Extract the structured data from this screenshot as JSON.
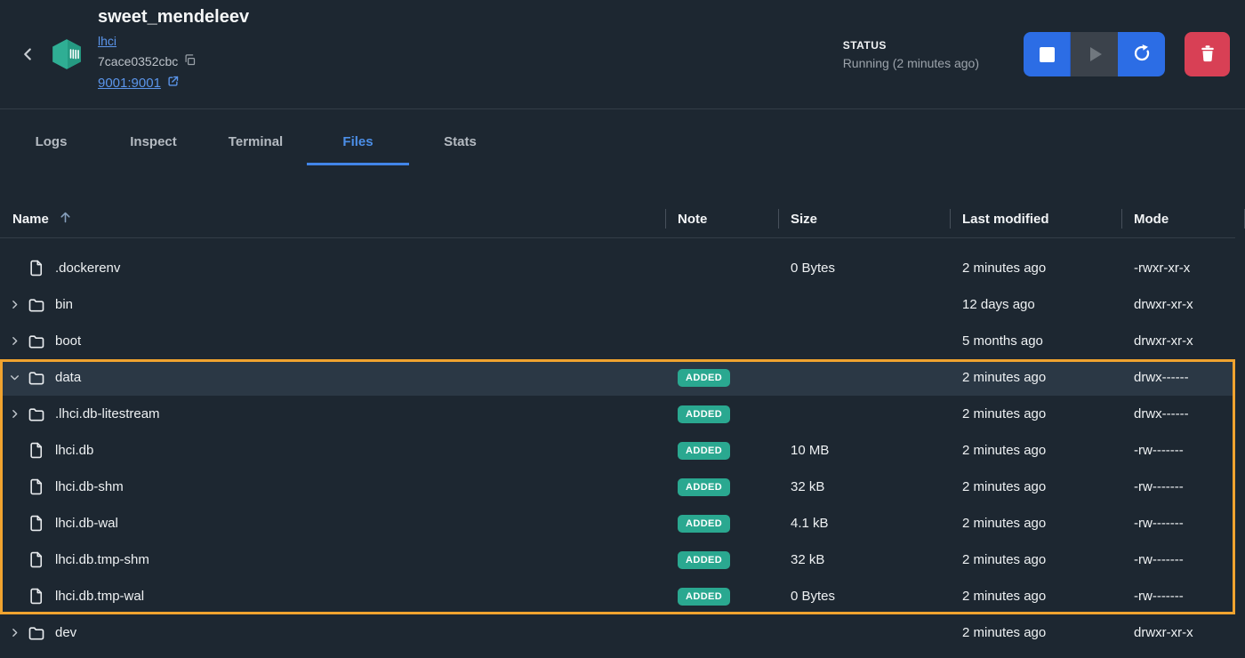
{
  "header": {
    "title": "sweet_mendeleev",
    "image_link": "lhci",
    "container_id": "7cace0352cbc",
    "port_mapping": "9001:9001",
    "status_label": "STATUS",
    "status_value": "Running (2 minutes ago)"
  },
  "tabs": [
    {
      "label": "Logs",
      "active": false
    },
    {
      "label": "Inspect",
      "active": false
    },
    {
      "label": "Terminal",
      "active": false
    },
    {
      "label": "Files",
      "active": true
    },
    {
      "label": "Stats",
      "active": false
    }
  ],
  "table": {
    "columns": [
      "Name",
      "Note",
      "Size",
      "Last modified",
      "Mode"
    ],
    "sort_column": "Name",
    "sort_direction": "ascending",
    "rows": [
      {
        "name": ".dockerenv",
        "type": "file",
        "indent": 0,
        "expandable": false,
        "expanded": false,
        "note": "",
        "size": "0 Bytes",
        "modified": "2 minutes ago",
        "mode": "-rwxr-xr-x",
        "selected": false,
        "in_group": false
      },
      {
        "name": "bin",
        "type": "folder",
        "indent": 0,
        "expandable": true,
        "expanded": false,
        "note": "",
        "size": "",
        "modified": "12 days ago",
        "mode": "drwxr-xr-x",
        "selected": false,
        "in_group": false
      },
      {
        "name": "boot",
        "type": "folder",
        "indent": 0,
        "expandable": true,
        "expanded": false,
        "note": "",
        "size": "",
        "modified": "5 months ago",
        "mode": "drwxr-xr-x",
        "selected": false,
        "in_group": false
      },
      {
        "name": "data",
        "type": "folder",
        "indent": 0,
        "expandable": true,
        "expanded": true,
        "note": "ADDED",
        "size": "",
        "modified": "2 minutes ago",
        "mode": "drwx------",
        "selected": true,
        "in_group": true
      },
      {
        "name": ".lhci.db-litestream",
        "type": "folder",
        "indent": 1,
        "expandable": true,
        "expanded": false,
        "note": "ADDED",
        "size": "",
        "modified": "2 minutes ago",
        "mode": "drwx------",
        "selected": false,
        "in_group": true
      },
      {
        "name": "lhci.db",
        "type": "file",
        "indent": 1,
        "expandable": false,
        "expanded": false,
        "note": "ADDED",
        "size": "10 MB",
        "modified": "2 minutes ago",
        "mode": "-rw-------",
        "selected": false,
        "in_group": true
      },
      {
        "name": "lhci.db-shm",
        "type": "file",
        "indent": 1,
        "expandable": false,
        "expanded": false,
        "note": "ADDED",
        "size": "32 kB",
        "modified": "2 minutes ago",
        "mode": "-rw-------",
        "selected": false,
        "in_group": true
      },
      {
        "name": "lhci.db-wal",
        "type": "file",
        "indent": 1,
        "expandable": false,
        "expanded": false,
        "note": "ADDED",
        "size": "4.1 kB",
        "modified": "2 minutes ago",
        "mode": "-rw-------",
        "selected": false,
        "in_group": true
      },
      {
        "name": "lhci.db.tmp-shm",
        "type": "file",
        "indent": 1,
        "expandable": false,
        "expanded": false,
        "note": "ADDED",
        "size": "32 kB",
        "modified": "2 minutes ago",
        "mode": "-rw-------",
        "selected": false,
        "in_group": true
      },
      {
        "name": "lhci.db.tmp-wal",
        "type": "file",
        "indent": 1,
        "expandable": false,
        "expanded": false,
        "note": "ADDED",
        "size": "0 Bytes",
        "modified": "2 minutes ago",
        "mode": "-rw-------",
        "selected": false,
        "in_group": true
      },
      {
        "name": "dev",
        "type": "folder",
        "indent": 0,
        "expandable": true,
        "expanded": false,
        "note": "",
        "size": "",
        "modified": "2 minutes ago",
        "mode": "drwxr-xr-x",
        "selected": false,
        "in_group": false
      }
    ]
  },
  "icons": {
    "back": "back-chevron-icon",
    "container": "container-cube-icon",
    "copy": "copy-icon",
    "external": "external-link-icon",
    "stop": "stop-icon",
    "play": "play-icon",
    "restart": "restart-icon",
    "delete": "trash-icon",
    "sort": "sort-ascending-icon"
  },
  "colors": {
    "background": "#1d2731",
    "selected_row": "#2b3845",
    "group_highlight": "#f0a32f",
    "badge_added": "#2aa890",
    "accent_blue": "#2c6de5",
    "tab_active_blue": "#4c8fe8",
    "link_blue": "#5b95ea",
    "delete_red": "#d84055",
    "icon_teal": "#2aa891"
  }
}
